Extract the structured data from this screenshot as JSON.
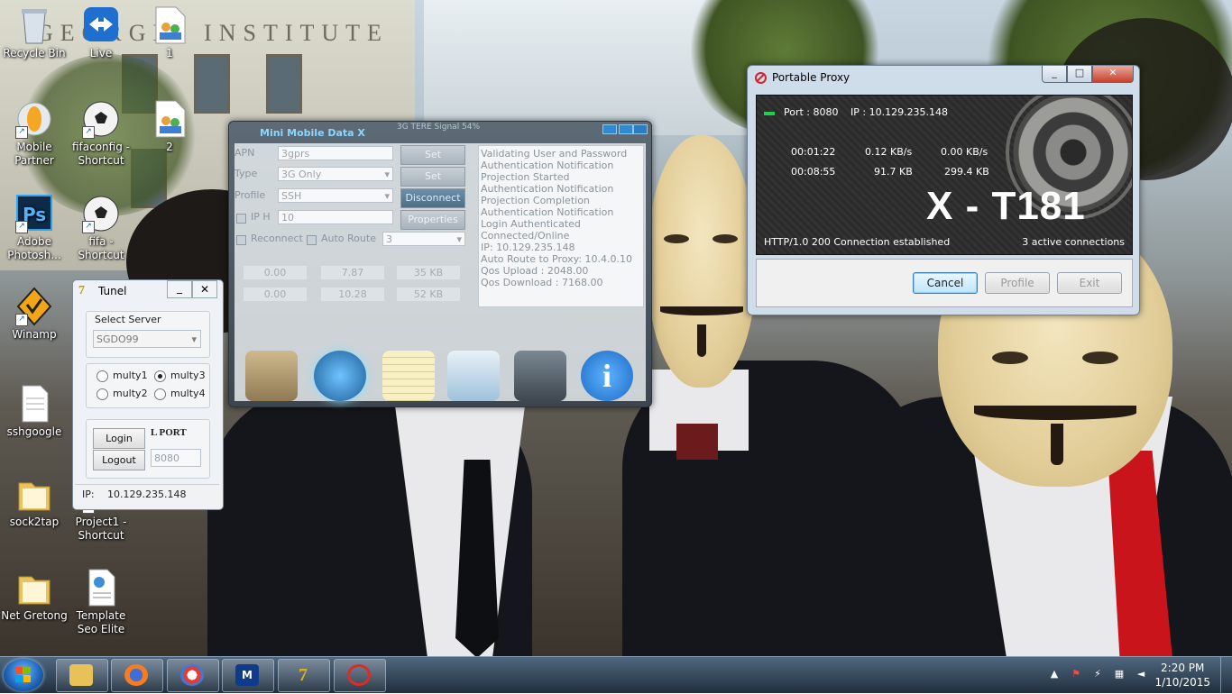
{
  "desktop": {
    "wallpaper_text": "GEORGIA INSTITUTE",
    "icons": [
      {
        "label": "Recycle Bin",
        "icon": "recycle-bin-icon"
      },
      {
        "label": "Live",
        "icon": "teamviewer-icon"
      },
      {
        "label": "1",
        "icon": "users-doc-icon"
      },
      {
        "label": "Mobile\nPartner",
        "icon": "mobile-partner-icon"
      },
      {
        "label": "fifaconfig -\nShortcut",
        "icon": "soccer-ball-icon"
      },
      {
        "label": "2",
        "icon": "users-doc-icon"
      },
      {
        "label": "Adobe\nPhotosh...",
        "icon": "photoshop-icon"
      },
      {
        "label": "fifa -\nShortcut",
        "icon": "soccer-ball-icon"
      },
      {
        "label": "Winamp",
        "icon": "winamp-icon"
      },
      {
        "label": "sshgoogle",
        "icon": "text-file-icon"
      },
      {
        "label": "sock2tap",
        "icon": "folder-icon"
      },
      {
        "label": "Project1 -\nShortcut",
        "icon": "app-shortcut-icon"
      },
      {
        "label": "Net Gretong",
        "icon": "folder-icon"
      },
      {
        "label": "Template\nSeo Elite",
        "icon": "web-document-icon"
      }
    ]
  },
  "proxy": {
    "title": "Portable Proxy",
    "port": "Port : 8080",
    "ip": "IP : 10.129.235.148",
    "row1": {
      "time": "00:01:22",
      "up": "0.12 KB/s",
      "down": "0.00 KB/s"
    },
    "row2": {
      "time": "00:08:55",
      "up": "91.7 KB",
      "down": "299.4 KB"
    },
    "brand": "X - T181",
    "status": "HTTP/1.0 200 Connection established",
    "connections": "3 active connections",
    "buttons": {
      "cancel": "Cancel",
      "profile": "Profile",
      "exit": "Exit"
    }
  },
  "mmdx": {
    "title": "Mini Mobile Data X",
    "signal": "3G TERE Signal 54%",
    "apn_label": "APN",
    "apn_value": "3gprs",
    "type_label": "Type",
    "type_value": "3G Only",
    "profile_label": "Profile",
    "profile_value": "SSH",
    "iph_label": "IP H",
    "iph_value": "10",
    "reconnect_label": "Reconnect",
    "autoroute_label": "Auto Route",
    "autoroute_value": "3",
    "buttons": {
      "set1": "Set",
      "set2": "Set",
      "disconnect": "Disconnect",
      "properties": "Properties"
    },
    "stats": [
      [
        "0.00",
        "7.87",
        "35 KB"
      ],
      [
        "0.00",
        "10.28",
        "52 KB"
      ]
    ],
    "log": [
      "Validating User and Password",
      "Authentication Notification",
      "Projection Started",
      "Authentication Notification",
      "Projection Completion",
      "Authentication Notification",
      "Login Authenticated",
      "Connected/Online",
      "IP: 10.129.235.148",
      "Auto Route to Proxy: 10.4.0.10",
      "Qos Upload : 2048.00",
      "Qos Download : 7168.00"
    ]
  },
  "tunel": {
    "title": "Tunel",
    "server_label": "Select Server",
    "server_value": "SGDO99",
    "options": [
      "multy1",
      "multy3",
      "multy2",
      "multy4"
    ],
    "selected": "multy3",
    "login": "Login",
    "logout": "Logout",
    "lport_label": "L PORT",
    "lport_value": "8080",
    "ip_label": "IP:",
    "ip_value": "10.129.235.148"
  },
  "taskbar": {
    "items": [
      "explorer-icon",
      "firefox-icon",
      "browser-icon",
      "m-app-icon",
      "tunel-app-icon",
      "proxy-stop-icon"
    ],
    "m_letter": "M",
    "time": "2:20 PM",
    "date": "1/10/2015"
  }
}
